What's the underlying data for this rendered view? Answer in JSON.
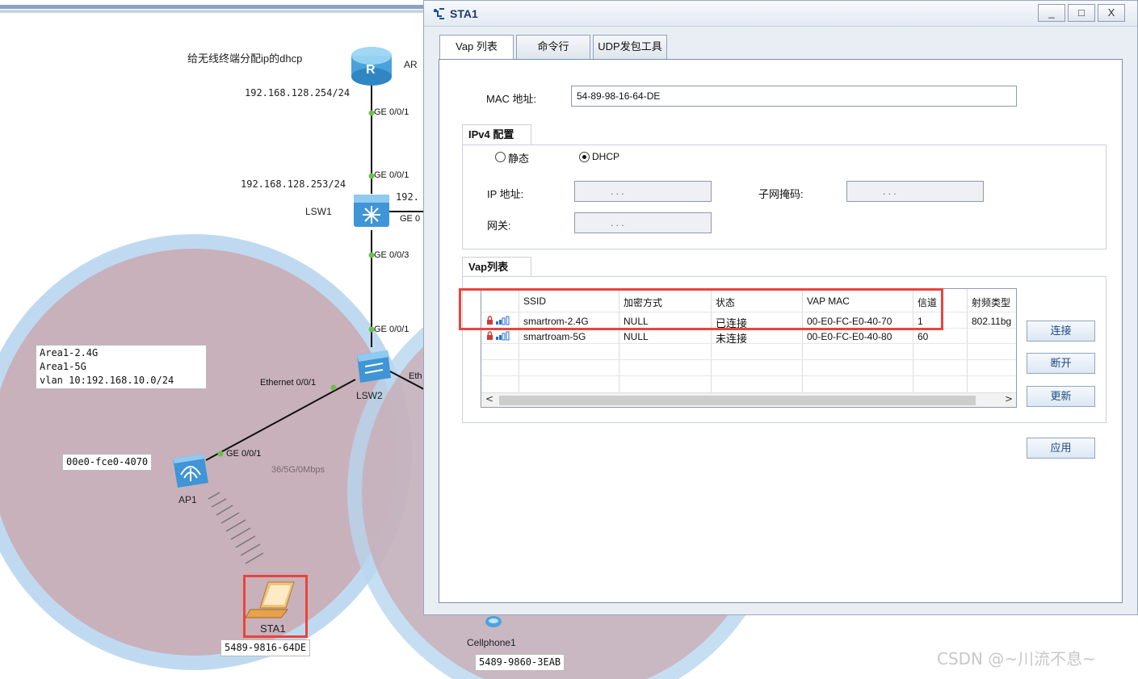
{
  "topology": {
    "router": {
      "name": "AR",
      "note": "给无线终端分配ip的dhcp",
      "ip": "192.168.128.254/24",
      "port": "GE 0/0/1"
    },
    "lsw1": {
      "name": "LSW1",
      "ip": "192.168.128.253/24",
      "port_top": "GE 0/0/1",
      "port_bottom": "GE 0/0/3",
      "ip_right": "192.",
      "port_right": "GE 0"
    },
    "lsw2": {
      "name": "LSW2",
      "port_top": "GE 0/0/1",
      "port_left": "Ethernet 0/0/1",
      "port_right": "Eth"
    },
    "ap1": {
      "name": "AP1",
      "port": "GE 0/0/1",
      "mac": "00e0-fce0-4070",
      "rate": "36/5G/0Mbps"
    },
    "area_note": [
      "Area1-2.4G",
      "Area1-5G",
      "vlan 10:192.168.10.0/24"
    ],
    "sta1": {
      "name": "STA1",
      "mac": "5489-9816-64DE"
    },
    "cellphone": {
      "name": "Cellphone1",
      "mac": "5489-9860-3EAB"
    }
  },
  "window": {
    "title": "STA1",
    "buttons": {
      "minimize": "_",
      "maximize": "□",
      "close": "X"
    },
    "tabs": [
      "Vap 列表",
      "命令行",
      "UDP发包工具"
    ],
    "mac_label": "MAC 地址:",
    "mac_value": "54-89-98-16-64-DE",
    "ipv4": {
      "group_title": "IPv4 配置",
      "static_label": "静态",
      "dhcp_label": "DHCP",
      "selected": "DHCP",
      "ip_label": "IP 地址:",
      "mask_label": "子网掩码:",
      "gateway_label": "网关:",
      "ip_dots": ".  .  ."
    },
    "vap": {
      "group_title": "Vap列表",
      "columns": [
        "SSID",
        "加密方式",
        "状态",
        "VAP MAC",
        "信道",
        "射频类型"
      ],
      "rows": [
        {
          "ssid": "smartrom-2.4G",
          "enc": "NULL",
          "status": "已连接",
          "mac": "00-E0-FC-E0-40-70",
          "channel": "1",
          "radio": "802.11bg"
        },
        {
          "ssid": "smartroam-5G",
          "enc": "NULL",
          "status": "未连接",
          "mac": "00-E0-FC-E0-40-80",
          "channel": "60",
          "radio": ""
        }
      ],
      "scroll_left": "<",
      "scroll_right": ">"
    },
    "actions": {
      "connect": "连接",
      "disconnect": "断开",
      "refresh": "更新",
      "apply": "应用"
    }
  },
  "watermark": "CSDN @~川流不息~",
  "colors": {
    "highlight": "#e8453c",
    "wifi_ring": "#b8d6ee",
    "wifi_fill": "#c9a9b2"
  }
}
